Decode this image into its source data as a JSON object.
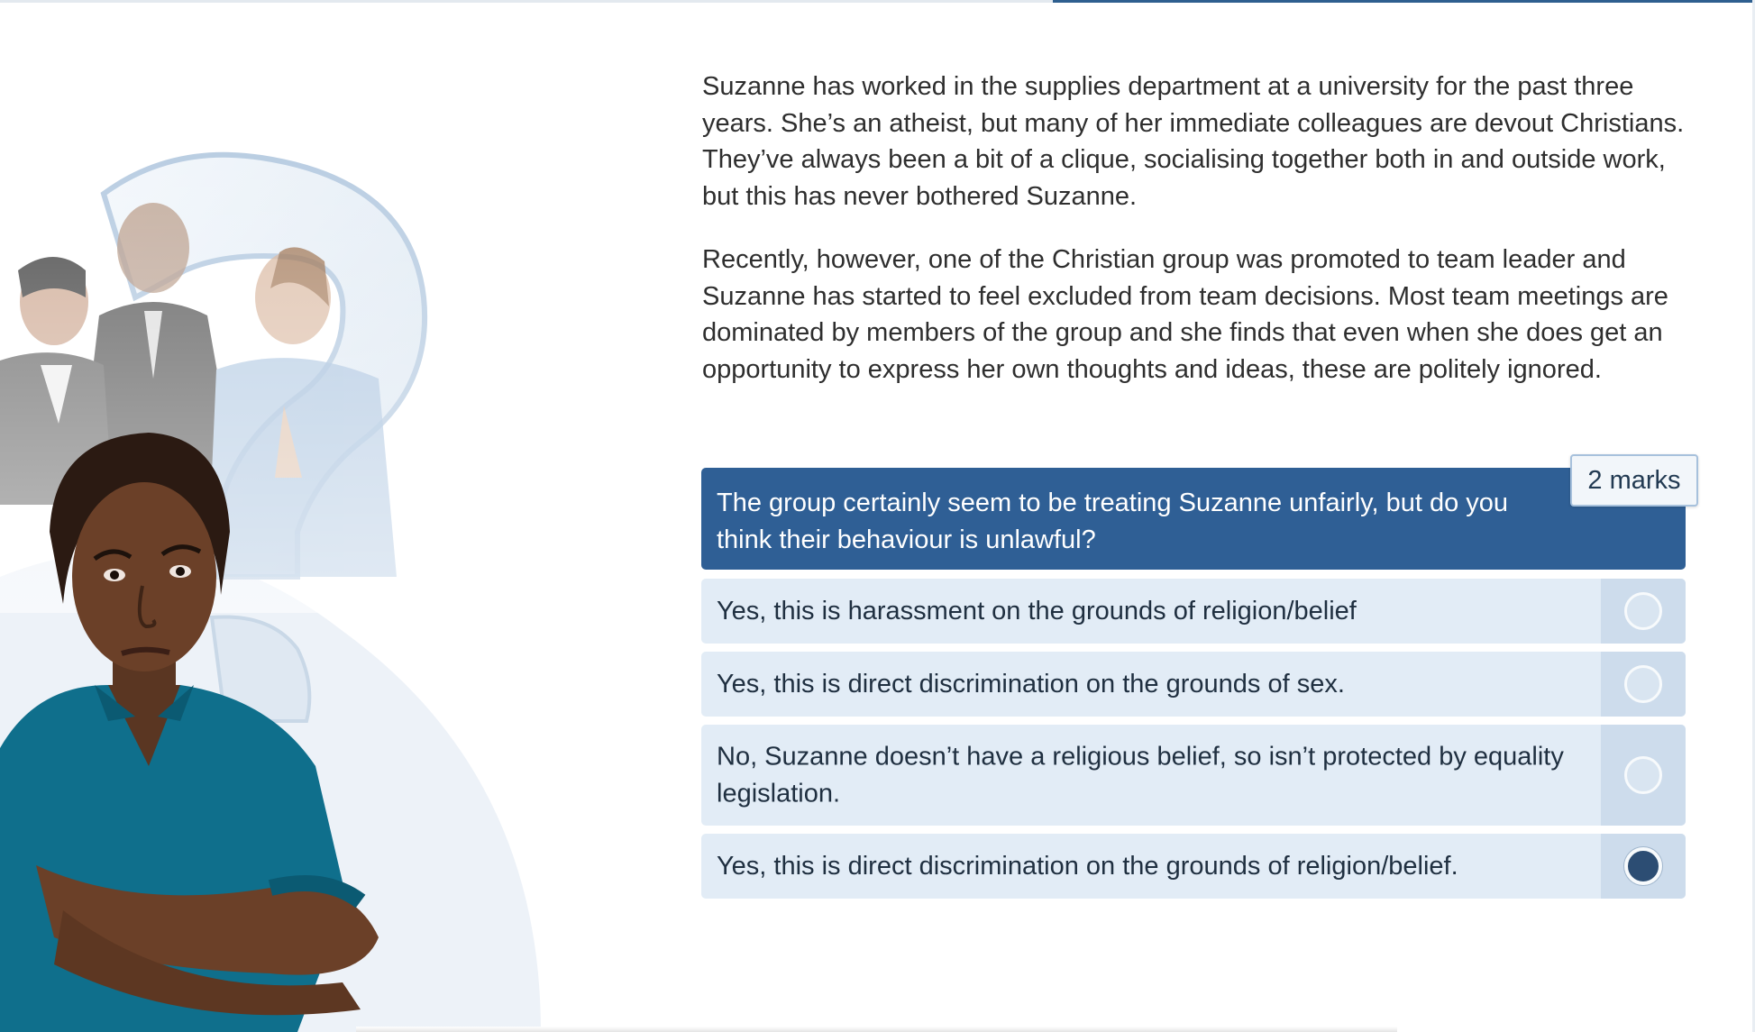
{
  "progress": {
    "fraction": 0.6
  },
  "scenario": {
    "paragraphs": [
      "Suzanne has worked in the supplies department at a university for the past three years. She’s an atheist, but many of her immediate colleagues are devout Christians. They’ve always been a bit of a clique, socialising together both in and outside work, but this has never bothered Suzanne.",
      "Recently, however, one of the Christian group was promoted to team leader and Suzanne has started to feel excluded from team decisions. Most team meetings are dominated by members of the group and she finds that even when she does get an opportunity to express her own thoughts and ideas, these are politely ignored."
    ]
  },
  "question": {
    "text": "The group certainly seem to be treating Suzanne unfairly, but do you think their behaviour is unlawful?",
    "marks": "2 marks"
  },
  "options": [
    {
      "label": "Yes, this is harassment on the grounds of religion/belief",
      "selected": false
    },
    {
      "label": "Yes, this is direct discrimination on the grounds of sex.",
      "selected": false
    },
    {
      "label": "No, Suzanne doesn’t have a religious belief, so isn’t protected by equality legislation.",
      "selected": false
    },
    {
      "label": "Yes, this is direct discrimination on the grounds of religion/belief.",
      "selected": true
    }
  ],
  "colors": {
    "question_bg": "#2f5f95",
    "option_bg": "#e2ecf6",
    "radio_selected": "#2c4d73",
    "shirt": "#0f6f8c"
  }
}
